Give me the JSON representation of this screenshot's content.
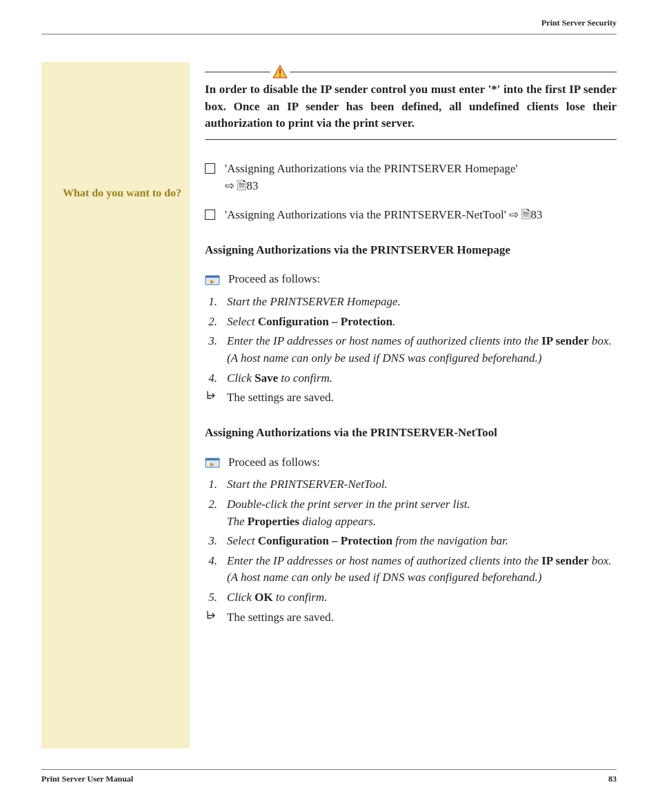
{
  "header": {
    "running_title": "Print Server Security"
  },
  "warning": {
    "text": "In order to disable the IP sender control you must enter '*' into the first IP sender box. Once an IP sender has been defined, all undefined clients lose their authorization to print via the print server."
  },
  "sidebar": {
    "prompt": "What do you want to do?"
  },
  "checklist": [
    {
      "text": "'Assigning Authorizations via the PRINTSERVER Homepage'",
      "ref_arrow": "⇨",
      "ref_page_glyph": "🗎",
      "ref_num": "83",
      "break_before_ref": true
    },
    {
      "text": "'Assigning Authorizations via the PRINTSERVER-NetTool'",
      "ref_arrow": "⇨",
      "ref_page_glyph": "🗎",
      "ref_num": "83",
      "break_before_ref": false
    }
  ],
  "sections": [
    {
      "heading": "Assigning Authorizations via the PRINTSERVER Homepage",
      "proceed_label": "Proceed as follows:",
      "steps": [
        {
          "n": "1.",
          "runs": [
            {
              "t": "Start the PRINTSERVER Homepage.",
              "i": true
            }
          ]
        },
        {
          "n": "2.",
          "runs": [
            {
              "t": "Select ",
              "i": true
            },
            {
              "t": "Configuration – Protection",
              "b": true
            },
            {
              "t": ".",
              "i": true
            }
          ]
        },
        {
          "n": "3.",
          "runs": [
            {
              "t": "Enter the IP addresses or host names of authorized clients into the ",
              "i": true
            },
            {
              "t": "IP sender",
              "b": true
            },
            {
              "t": " box. (A host name can only be used if DNS was configured beforehand.)",
              "i": true
            }
          ]
        },
        {
          "n": "4.",
          "runs": [
            {
              "t": "Click ",
              "i": true
            },
            {
              "t": "Save",
              "b": true
            },
            {
              "t": " to confirm.",
              "i": true
            }
          ]
        }
      ],
      "result": "The settings are saved."
    },
    {
      "heading": "Assigning Authorizations via the PRINTSERVER-NetTool",
      "proceed_label": "Proceed as follows:",
      "steps": [
        {
          "n": "1.",
          "runs": [
            {
              "t": "Start the PRINTSERVER-NetTool.",
              "i": true
            }
          ]
        },
        {
          "n": "2.",
          "runs": [
            {
              "t": "Double-click the print server in the print server list.",
              "i": true
            },
            {
              "t": "\nThe ",
              "i": true
            },
            {
              "t": "Properties",
              "b": true
            },
            {
              "t": " dialog appears.",
              "i": true
            }
          ]
        },
        {
          "n": "3.",
          "runs": [
            {
              "t": "Select ",
              "i": true
            },
            {
              "t": "Configuration – Protection",
              "b": true
            },
            {
              "t": " from the navigation bar.",
              "i": true
            }
          ]
        },
        {
          "n": "4.",
          "runs": [
            {
              "t": "Enter the IP addresses or host names of authorized clients into the ",
              "i": true
            },
            {
              "t": "IP sender",
              "b": true
            },
            {
              "t": " box. (A host name can only be used if DNS was configured beforehand.)",
              "i": true
            }
          ]
        },
        {
          "n": "5.",
          "runs": [
            {
              "t": "Click ",
              "i": true
            },
            {
              "t": "OK",
              "b": true
            },
            {
              "t": " to confirm.",
              "i": true
            }
          ]
        }
      ],
      "result": "The settings are saved."
    }
  ],
  "footer": {
    "manual_title": "Print Server User Manual",
    "page_number": "83"
  }
}
